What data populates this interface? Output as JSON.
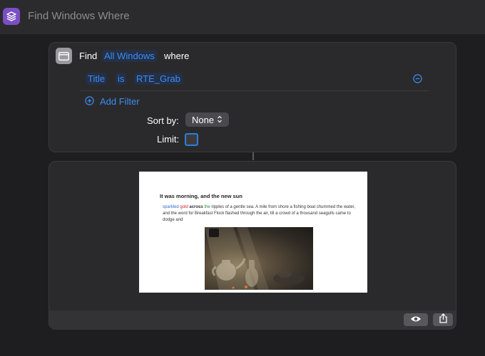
{
  "window": {
    "title": "Find Windows Where"
  },
  "action": {
    "find_label": "Find",
    "target": "All Windows",
    "where_label": "where",
    "filter": {
      "property": "Title",
      "operator": "is",
      "value": "RTE_Grab"
    },
    "add_filter_label": "Add Filter",
    "sort_label": "Sort by:",
    "sort_value": "None",
    "limit_label": "Limit:",
    "limit_enabled": false
  },
  "result": {
    "document": {
      "heading": "It was morning, and the new sun",
      "words": {
        "w1": "sparkled",
        "w2": "gold",
        "w3": "across",
        "w4": "the"
      },
      "paragraph_rest": " ripples of a gentle sea. A mile from shore a fishing boat chummed the water, and the word for Breakfast Flock flashed through the air, till a crowd of a thousand seagulls came to dodge and"
    },
    "icons": {
      "preview": "eye-icon",
      "share": "share-icon"
    }
  },
  "colors": {
    "accent": "#3c8cf2",
    "background": "#1e1e20",
    "card": "#2a2a2c",
    "app_icon": "#7b4fc4"
  }
}
